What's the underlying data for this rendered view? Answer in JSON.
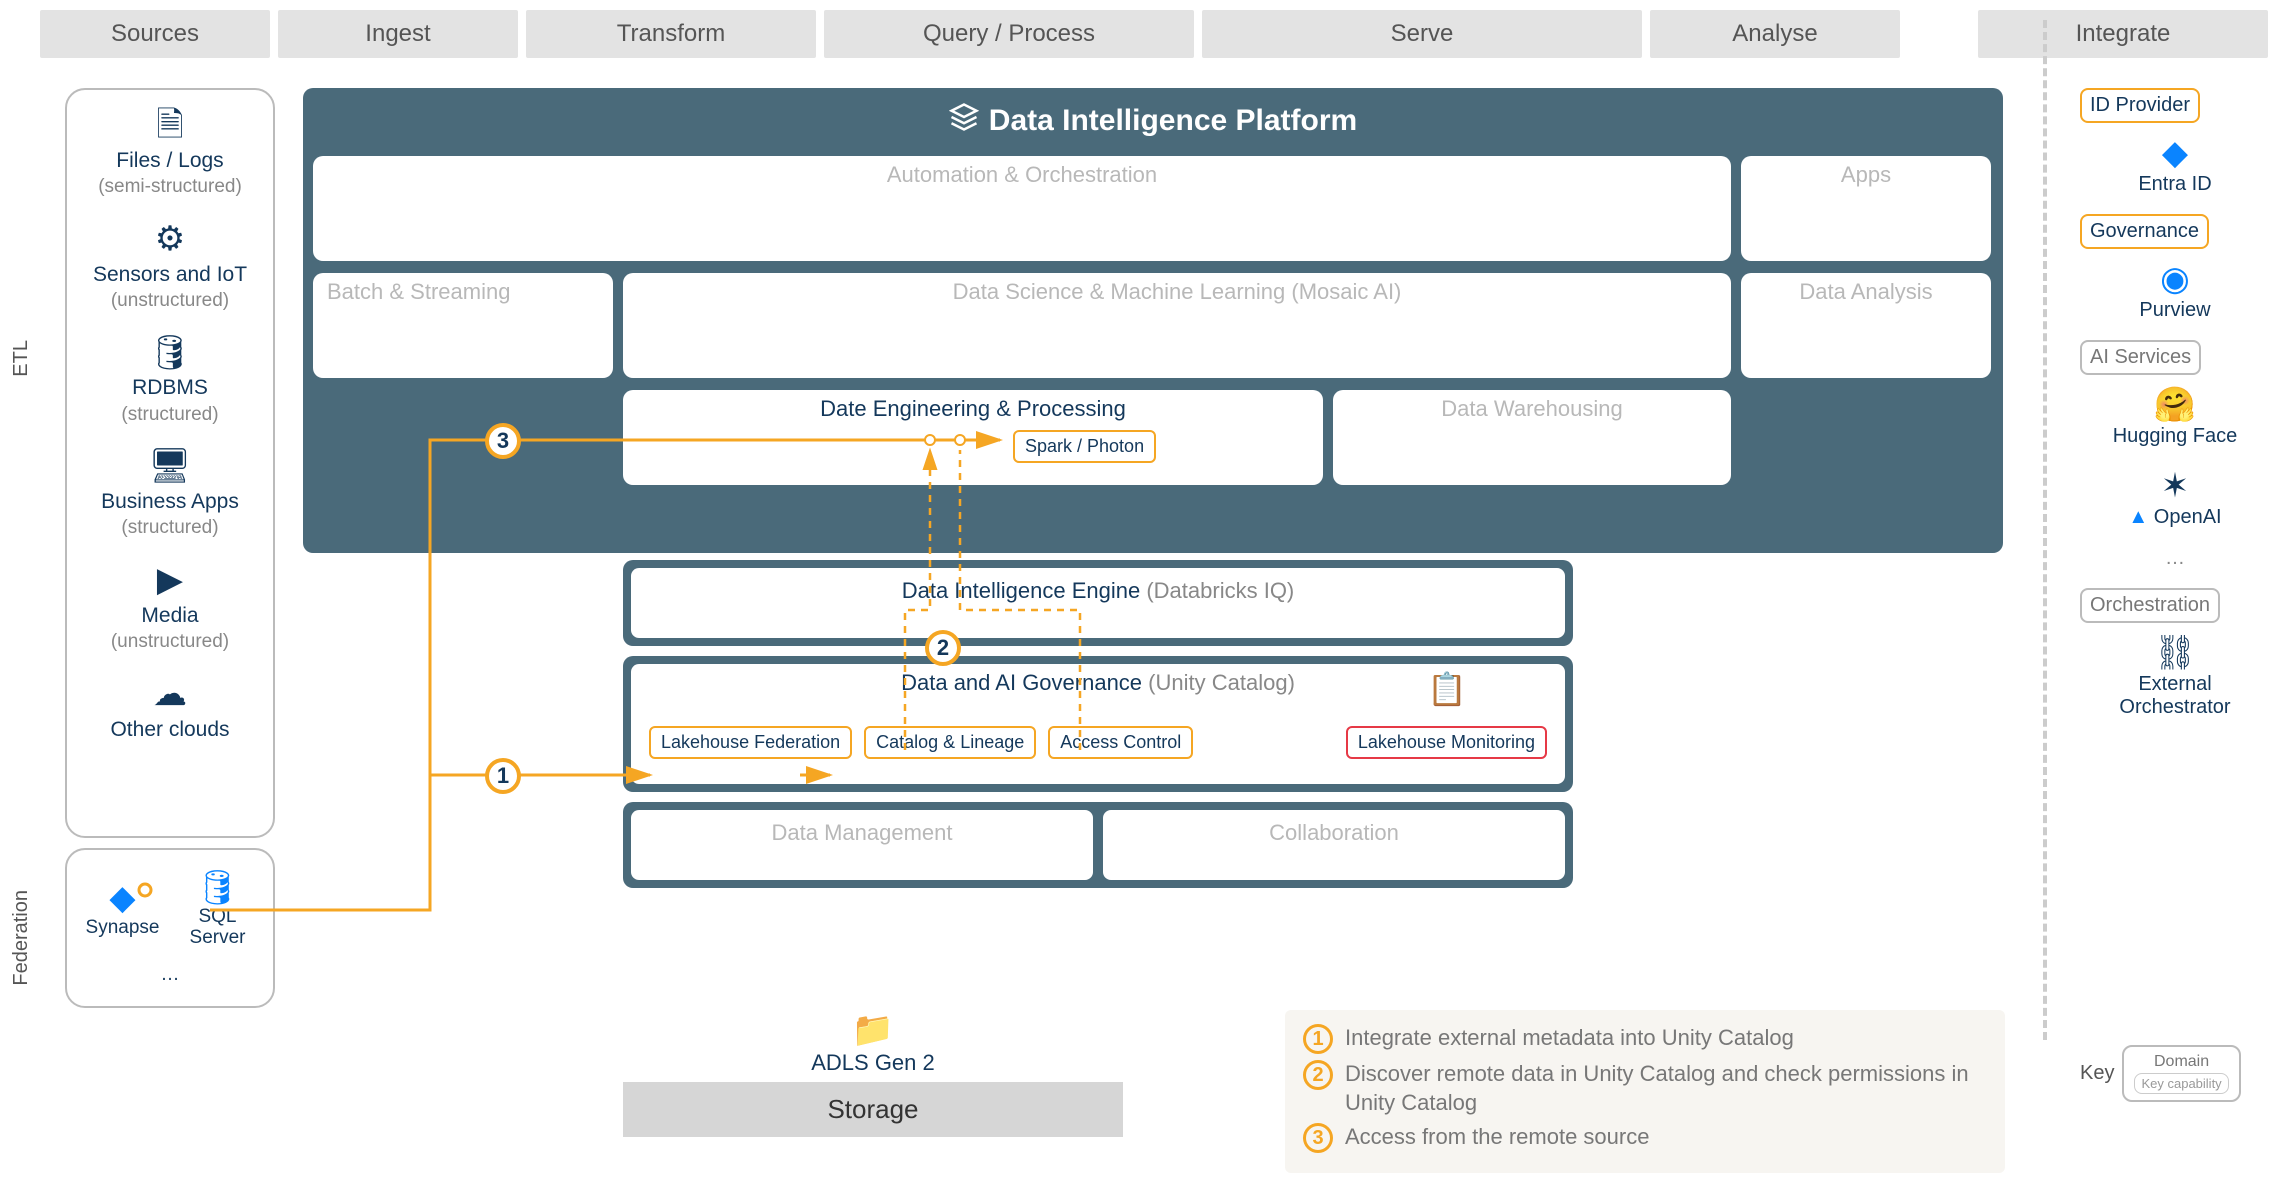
{
  "headers": {
    "sources": "Sources",
    "ingest": "Ingest",
    "transform": "Transform",
    "query": "Query / Process",
    "serve": "Serve",
    "analyse": "Analyse",
    "integrate": "Integrate"
  },
  "rails": {
    "etl": "ETL",
    "federation": "Federation"
  },
  "sources": {
    "files": {
      "title": "Files / Logs",
      "sub": "(semi-structured)"
    },
    "iot": {
      "title": "Sensors and IoT",
      "sub": "(unstructured)"
    },
    "rdbms": {
      "title": "RDBMS",
      "sub": "(structured)"
    },
    "apps": {
      "title": "Business Apps",
      "sub": "(structured)"
    },
    "media": {
      "title": "Media",
      "sub": "(unstructured)"
    },
    "clouds": {
      "title": "Other clouds",
      "sub": ""
    }
  },
  "federation_sources": {
    "synapse": "Synapse",
    "sql": "SQL Server",
    "more": "…"
  },
  "platform": {
    "title": "Data Intelligence Platform",
    "row1": {
      "auto": "Automation & Orchestration",
      "apps": "Apps"
    },
    "row2": {
      "bs": "Batch & Streaming",
      "ds": "Data Science & Machine Learning  (Mosaic AI)",
      "da": "Data Analysis"
    },
    "row3": {
      "de": "Date Engineering & Processing",
      "dw": "Data Warehousing",
      "spark": "Spark / Photon"
    },
    "engine": {
      "t": "Data Intelligence Engine",
      "s": "(Databricks IQ)"
    },
    "gov": {
      "t": "Data and AI Governance",
      "s": "(Unity Catalog)",
      "chips": {
        "lf": "Lakehouse Federation",
        "cl": "Catalog & Lineage",
        "ac": "Access Control",
        "lm": "Lakehouse Monitoring"
      }
    },
    "mgmt": {
      "dm": "Data Management",
      "collab": "Collaboration"
    }
  },
  "storage": {
    "adls": "ADLS Gen 2",
    "label": "Storage"
  },
  "legend": {
    "n1": "Integrate external metadata into Unity Catalog",
    "n2": "Discover remote data in Unity Catalog and check permissions in Unity Catalog",
    "n3": "Access from the remote source"
  },
  "integrate": {
    "idp": "ID Provider",
    "entra": "Entra ID",
    "govh": "Governance",
    "purview": "Purview",
    "aih": "AI Services",
    "hf": "Hugging Face",
    "openai": "OpenAI",
    "more": "…",
    "orchh": "Orchestration",
    "ext": "External Orchestrator"
  },
  "key": {
    "label": "Key",
    "domain": "Domain",
    "cap": "Key capability"
  },
  "colors": {
    "platform_bg": "#4a6a7a",
    "accent": "#f5a623",
    "ink": "#14385b"
  }
}
